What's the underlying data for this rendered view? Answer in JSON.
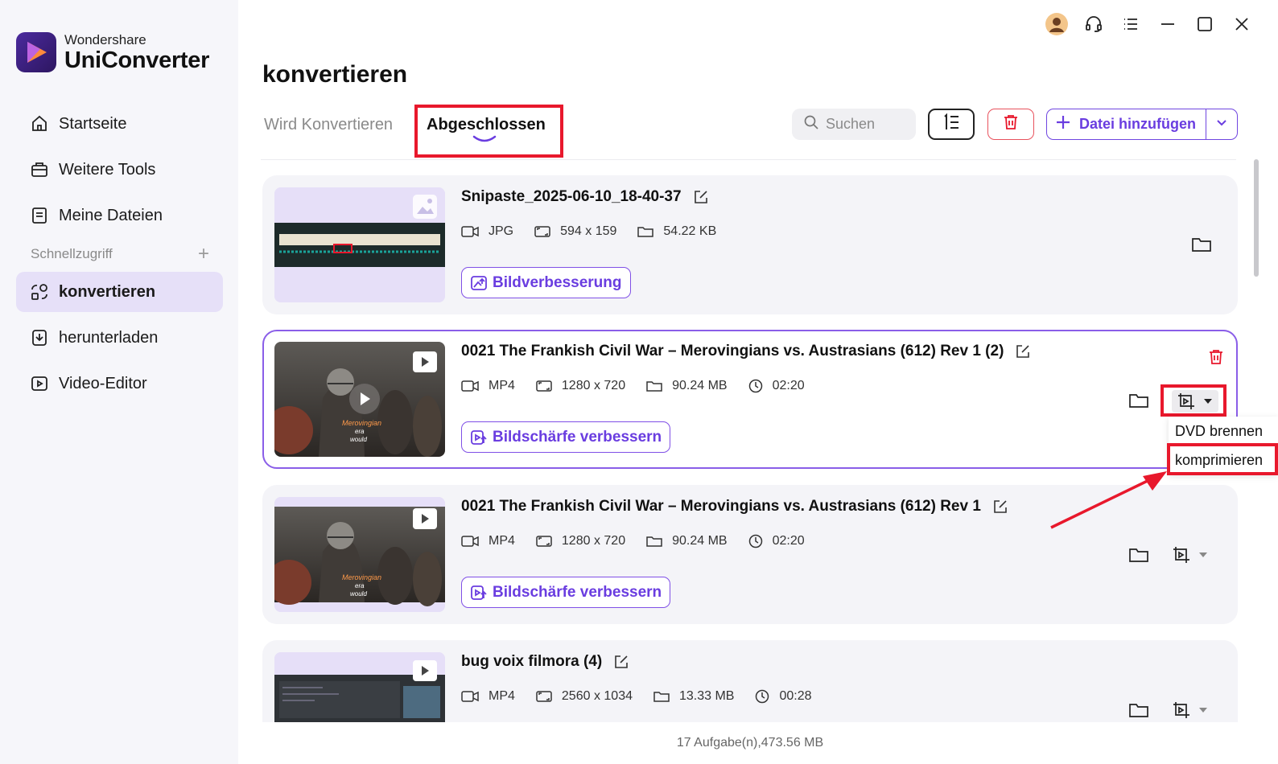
{
  "app": {
    "brand": "Wondershare",
    "product": "UniConverter"
  },
  "sidebar": {
    "items": [
      {
        "label": "Startseite",
        "icon": "home-icon"
      },
      {
        "label": "Weitere Tools",
        "icon": "toolbox-icon"
      },
      {
        "label": "Meine Dateien",
        "icon": "file-icon"
      }
    ],
    "quick_access": "Schnellzugriff",
    "quick_items": [
      {
        "label": "konvertieren",
        "icon": "convert-icon",
        "active": true
      },
      {
        "label": "herunterladen",
        "icon": "download-icon"
      },
      {
        "label": "Video-Editor",
        "icon": "video-editor-icon"
      }
    ]
  },
  "header": {
    "title": "konvertieren",
    "tabs": [
      {
        "label": "Wird Konvertieren"
      },
      {
        "label": "Abgeschlossen"
      }
    ],
    "search_placeholder": "Suchen",
    "add_file": "Datei hinzufügen"
  },
  "files": [
    {
      "name": "Snipaste_2025-06-10_18-40-37",
      "format": "JPG",
      "resolution": "594 x 159",
      "size": "54.22 KB",
      "duration": "",
      "action": "Bildverbesserung"
    },
    {
      "name": "0021 The Frankish Civil War – Merovingians vs. Austrasians (612) Rev 1 (2)",
      "format": "MP4",
      "resolution": "1280 x 720",
      "size": "90.24 MB",
      "duration": "02:20",
      "action": "Bildschärfe verbessern"
    },
    {
      "name": "0021 The Frankish Civil War – Merovingians vs. Austrasians (612) Rev 1",
      "format": "MP4",
      "resolution": "1280 x 720",
      "size": "90.24 MB",
      "duration": "02:20",
      "action": "Bildschärfe verbessern"
    },
    {
      "name": "bug voix filmora (4)",
      "format": "MP4",
      "resolution": "2560 x 1034",
      "size": "13.33 MB",
      "duration": "00:28",
      "action": ""
    }
  ],
  "thumb_text": {
    "line1": "Merovingian",
    "line2": "era",
    "line3": "would"
  },
  "dropdown": {
    "items": [
      "DVD brennen",
      "komprimieren"
    ]
  },
  "status": "17 Aufgabe(n),473.56 MB",
  "colors": {
    "accent": "#6a3de0",
    "highlight": "#e8182c",
    "sidebar_bg": "#f6f6fa"
  }
}
